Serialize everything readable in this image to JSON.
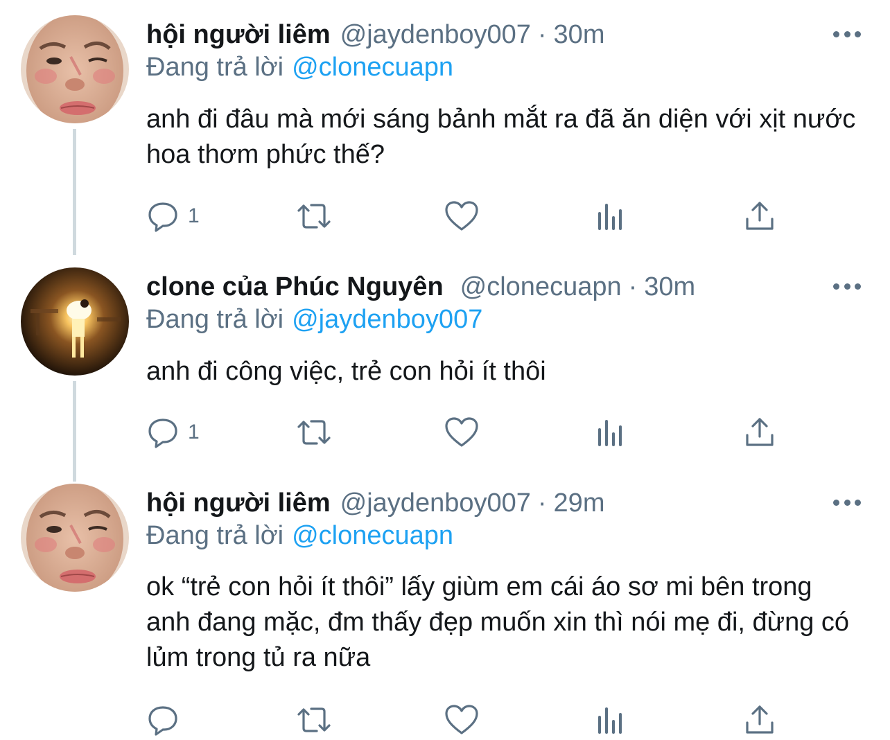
{
  "tweets": [
    {
      "name": "hội người liêm",
      "handle": "@jaydenboy007",
      "dot": "·",
      "time": "30m",
      "replying_prefix": "Đang trả lời",
      "replying_to": "@clonecuapn",
      "text": "anh đi đâu mà mới sáng bảnh mắt ra đã ăn diện với xịt nước hoa thơm phức thế?",
      "reply_count": "1",
      "avatar_icon": "person-face-avatar"
    },
    {
      "name": "clone của Phúc Nguyên",
      "handle": "@clonecuapn",
      "dot": "·",
      "time": "30m",
      "replying_prefix": "Đang trả lời",
      "replying_to": "@jaydenboy007",
      "text": "anh đi công việc, trẻ con hỏi ít thôi",
      "reply_count": "1",
      "avatar_icon": "glowing-figure-avatar"
    },
    {
      "name": "hội người liêm",
      "handle": "@jaydenboy007",
      "dot": "·",
      "time": "29m",
      "replying_prefix": "Đang trả lời",
      "replying_to": "@clonecuapn",
      "text": "ok “trẻ con hỏi ít thôi” lấy giùm em cái áo sơ mi bên trong anh đang mặc, đm thấy đẹp muốn xin thì nói mẹ đi, đừng có lủm trong tủ ra nữa",
      "reply_count": "",
      "avatar_icon": "person-face-avatar"
    }
  ],
  "icons": {
    "reply": "reply-icon",
    "retweet": "retweet-icon",
    "like": "like-icon",
    "analytics": "analytics-icon",
    "share": "share-icon",
    "more": "more-icon"
  },
  "colors": {
    "text": "#14171a",
    "secondary": "#5b7083",
    "mention": "#1da1f2",
    "thread_line": "#cfd9de"
  }
}
